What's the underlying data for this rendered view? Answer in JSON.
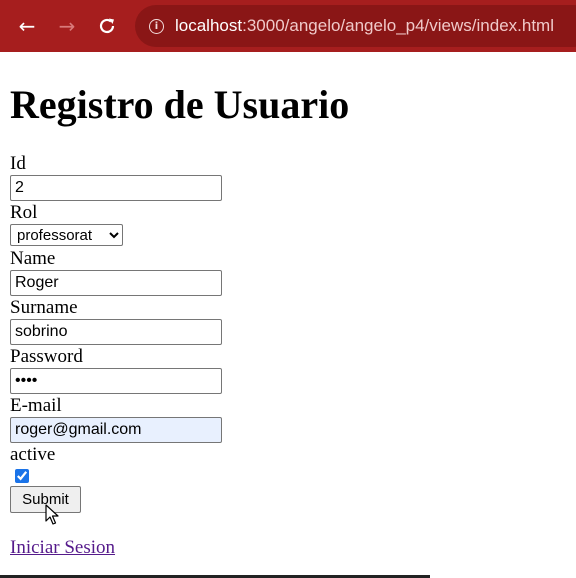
{
  "browser": {
    "url_host": "localhost",
    "url_rest": ":3000/angelo/angelo_p4/views/index.html"
  },
  "page": {
    "title": "Registro de Usuario",
    "fields": {
      "id": {
        "label": "Id",
        "value": "2"
      },
      "rol": {
        "label": "Rol",
        "value": "professorat",
        "options": [
          "professorat"
        ]
      },
      "name": {
        "label": "Name",
        "value": "Roger"
      },
      "surname": {
        "label": "Surname",
        "value": "sobrino"
      },
      "password": {
        "label": "Password",
        "value": "••••"
      },
      "email": {
        "label": "E-mail",
        "value": "roger@gmail.com"
      },
      "active": {
        "label": "active",
        "checked": true
      }
    },
    "submit_label": "Submit",
    "login_link": "Iniciar Sesion"
  }
}
